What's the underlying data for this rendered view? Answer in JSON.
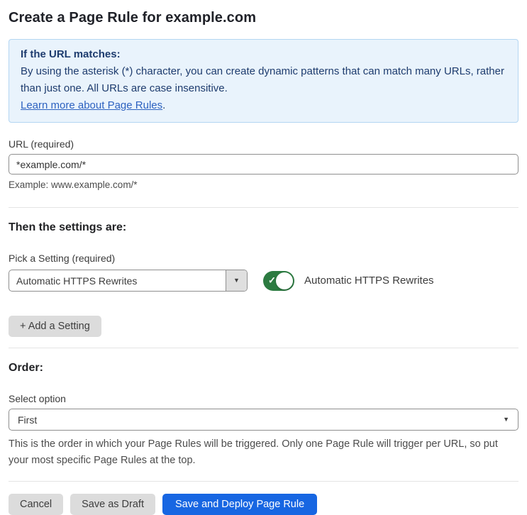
{
  "page": {
    "title": "Create a Page Rule for example.com"
  },
  "info_box": {
    "heading": "If the URL matches:",
    "body": "By using the asterisk (*) character, you can create dynamic patterns that can match many URLs, rather than just one. All URLs are case insensitive.",
    "link_label": "Learn more about Page Rules",
    "link_suffix": "."
  },
  "url_field": {
    "label": "URL (required)",
    "value": "*example.com/*",
    "helper": "Example: www.example.com/*"
  },
  "settings_section": {
    "heading": "Then the settings are:",
    "picker_label": "Pick a Setting (required)",
    "picker_value": "Automatic HTTPS Rewrites",
    "toggle_label": "Automatic HTTPS Rewrites",
    "toggle_state": "on",
    "add_button_label": "+ Add a Setting"
  },
  "order_section": {
    "heading": "Order:",
    "select_label": "Select option",
    "select_value": "First",
    "helper": "This is the order in which your Page Rules will be triggered. Only one Page Rule will trigger per URL, so put your most specific Page Rules at the top."
  },
  "footer": {
    "cancel_label": "Cancel",
    "save_draft_label": "Save as Draft",
    "save_deploy_label": "Save and Deploy Page Rule"
  },
  "icons": {
    "chevron_down": "▼",
    "check": "✓"
  },
  "colors": {
    "title_text": "#1f2128",
    "info_bg": "#e9f3fc",
    "info_border": "#b3d6f2",
    "info_text": "#1e3c6e",
    "link_blue": "#2d62c0",
    "control_border": "#8f8f8f",
    "divider": "#e4e4e4",
    "toggle_green": "#2c7b41",
    "gray_btn_bg": "#dcdcdc",
    "button_blue": "#1766e2"
  }
}
